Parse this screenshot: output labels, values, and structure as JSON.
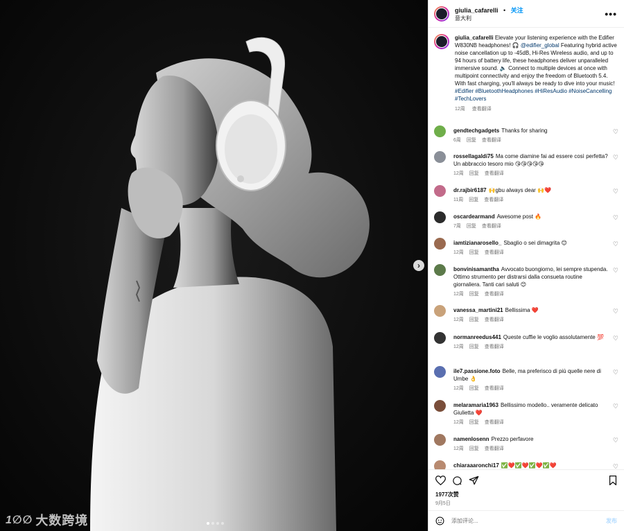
{
  "media": {
    "next_glyph": "›",
    "dots_count": 4,
    "active_dot": 1,
    "watermark_logo": "1∅∅",
    "watermark_text": "大数跨境"
  },
  "post": {
    "username": "giulia_cafarelli",
    "separator": "•",
    "follow": "关注",
    "location": "意大利",
    "more_glyph": "•••",
    "caption": {
      "username": "giulia_cafarelli",
      "text_1": " Elevate your listening experience with the Edifier W830NB headphones! 🎧 ",
      "mention": "@edifier_global",
      "text_2": " Featuring hybrid active noise cancellation up to -45dB, Hi-Res Wireless audio, and up to 94 hours of battery life, these headphones deliver unparalleled immersive sound. 🔈 Connect to multiple devices at once with multipoint connectivity and enjoy the freedom of Bluetooth 5.4. With fast charging, you'll always be ready to dive into your music! ",
      "hashtags": "#Edifier #BluetoothHeadphones #HiResAudio #NoiseCancelling #TechLovers",
      "time": "12周",
      "translate": "查看翻译"
    },
    "comments": [
      {
        "user": "gendtechgadgets",
        "text": "Thanks for sharing",
        "time": "6周",
        "reply": "回复",
        "translate": "查看翻译",
        "avatar_color": "#6fae4a"
      },
      {
        "user": "rossellagaldi75",
        "text": "Ma come diamine fai ad essere così perfetta? Un abbraccio tesoro mio 😘😘😘😘😘",
        "time": "12周",
        "reply": "回复",
        "translate": "查看翻译",
        "avatar_color": "#8a8f98"
      },
      {
        "user": "dr.rajbir6187",
        "text": "🙌gbu always dear 🙌❤️",
        "time": "11周",
        "reply": "回复",
        "translate": "查看翻译",
        "avatar_color": "#c26b8a"
      },
      {
        "user": "oscardearmand",
        "text": "Awesome post 🔥",
        "time": "7周",
        "reply": "回复",
        "translate": "查看翻译",
        "avatar_color": "#2b2b2b"
      },
      {
        "user": "iamtizianarosello_",
        "text": "Sbaglio o sei dimagrita 😊",
        "time": "12周",
        "reply": "回复",
        "translate": "查看翻译",
        "avatar_color": "#9a6a4f"
      },
      {
        "user": "bonvinisamantha",
        "text": "Avvocato buongiorno, lei sempre stupenda. Ottimo strumento per distrarsi dalla consueta routine giornaliera. Tanti cari saluti 😊",
        "time": "12周",
        "reply": "回复",
        "translate": "查看翻译",
        "avatar_color": "#5c7a4a"
      },
      {
        "user": "vanessa_martini21",
        "text": "Bellissima ❤️",
        "time": "12周",
        "reply": "回复",
        "translate": "查看翻译",
        "avatar_color": "#c9a27a"
      },
      {
        "user": "normanreedus441",
        "text": "Queste cuffie le voglio assolutamente 💯",
        "time": "12周",
        "reply": "回复",
        "translate": "查看翻译",
        "avatar_color": "#333333"
      },
      {
        "user": "ile7.passione.foto",
        "text": "Belle, ma preferisco di più quelle nere di Umbe 👌",
        "time": "12周",
        "reply": "回复",
        "translate": "查看翻译",
        "avatar_color": "#5a6fb0"
      },
      {
        "user": "melaramaria1963",
        "text": "Bellissimo modello.. veramente delicato Giulietta ❤️",
        "time": "12周",
        "reply": "回复",
        "translate": "查看翻译",
        "avatar_color": "#7a4e3a"
      },
      {
        "user": "namenlosenn",
        "text": "Prezzo perfavore",
        "time": "12周",
        "reply": "回复",
        "translate": "查看翻译",
        "avatar_color": "#a07860"
      },
      {
        "user": "chiaraaaronchi17",
        "text": "✅❤️✅❤️✅❤️✅❤️",
        "time": "",
        "reply": "",
        "translate": "",
        "avatar_color": "#b88a70"
      }
    ],
    "likes": "1977次赞",
    "date": "9月5日",
    "add_comment_placeholder": "添加评论...",
    "post_label": "发布"
  }
}
